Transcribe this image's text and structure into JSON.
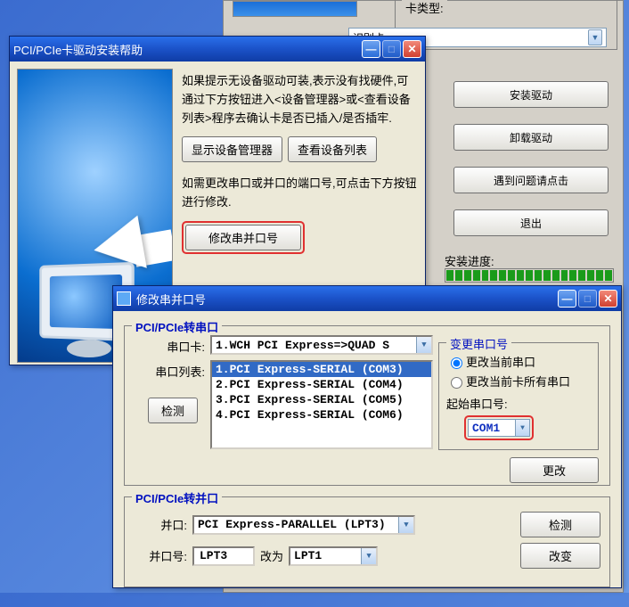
{
  "bg": {
    "card_type_legend": "卡类型:",
    "card_type_value": "识别卡",
    "buttons": [
      "安装驱动",
      "卸载驱动",
      "遇到问题请点击",
      "退出"
    ],
    "progress_legend": "安装进度:"
  },
  "help_dlg": {
    "title": "PCI/PCIe卡驱动安装帮助",
    "p1": "如果提示无设备驱动可装,表示没有找硬件,可通过下方按钮进入<设备管理器>或<查看设备列表>程序去确认卡是否已插入/是否插牢.",
    "btn_devmgr": "显示设备管理器",
    "btn_devlist": "查看设备列表",
    "p2": "如需更改串口或并口的端口号,可点击下方按钮进行修改.",
    "btn_modify": "修改串并口号"
  },
  "mod_dlg": {
    "title": "修改串并口号",
    "serial_fieldset": {
      "legend": "PCI/PCIe转串口",
      "card_label": "串口卡:",
      "card_value": "1.WCH PCI Express=>QUAD S",
      "list_label": "串口列表:",
      "list_items": [
        "1.PCI Express-SERIAL (COM3)",
        "2.PCI Express-SERIAL (COM4)",
        "3.PCI Express-SERIAL (COM5)",
        "4.PCI Express-SERIAL (COM6)"
      ],
      "list_selected": 0,
      "btn_detect": "检测",
      "change_frame_legend": "变更串口号",
      "radio_current": "更改当前串口",
      "radio_all": "更改当前卡所有串口",
      "start_label": "起始串口号:",
      "start_value": "COM1",
      "btn_change": "更改"
    },
    "parallel_fieldset": {
      "legend": "PCI/PCIe转并口",
      "port_label": "并口:",
      "port_value": "PCI Express-PARALLEL (LPT3)",
      "num_label": "并口号:",
      "num_value": "LPT3",
      "changeto_label": "改为",
      "changeto_value": "LPT1",
      "btn_detect": "检测",
      "btn_change": "改变"
    }
  }
}
